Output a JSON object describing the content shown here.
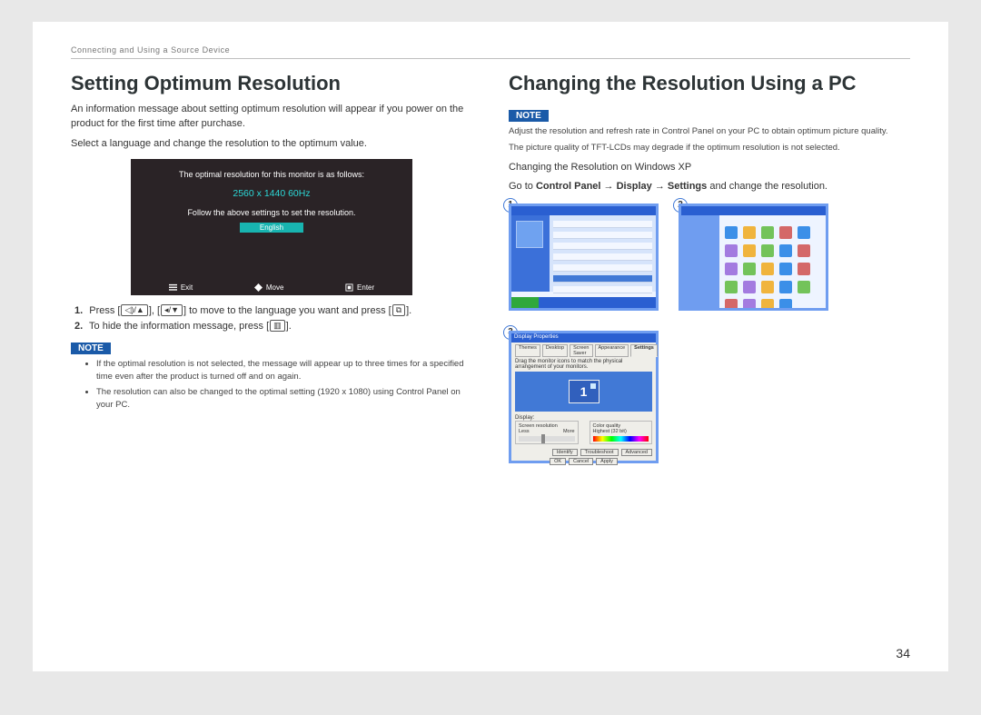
{
  "running_head": "Connecting and Using a Source Device",
  "page_number": "34",
  "left": {
    "heading": "Setting Optimum Resolution",
    "intro1": "An information message about setting optimum resolution will appear if you power on the product for the first time after purchase.",
    "intro2": "Select a language and change the resolution to the optimum value.",
    "osd": {
      "line1": "The optimal resolution for this monitor is as follows:",
      "resolution": "2560 x 1440  60Hz",
      "line2": "Follow the above settings to set the resolution.",
      "language": "English",
      "footer": {
        "exit": "Exit",
        "move": "Move",
        "enter": "Enter"
      }
    },
    "steps": [
      {
        "n": "1.",
        "pre": "Press [",
        "mid": "] to move to the language you want and press [",
        "post": "]."
      },
      {
        "n": "2.",
        "pre": "To hide the information message, press [",
        "post": "]."
      }
    ],
    "note_label": "NOTE",
    "notes": [
      "If the optimal resolution is not selected, the message will appear up to three times for a specified time even after the product is turned off and on again.",
      "The resolution can also be changed to the optimal setting (1920 x 1080) using Control Panel on your PC."
    ]
  },
  "right": {
    "heading": "Changing the Resolution Using a PC",
    "note_label": "NOTE",
    "notes": [
      "Adjust the resolution and refresh rate in Control Panel on your PC to obtain optimum picture quality.",
      "The picture quality of TFT-LCDs may degrade if the optimum resolution is not selected."
    ],
    "subheading": "Changing the Resolution on Windows XP",
    "instruction_pre": "Go to ",
    "instruction_cp": "Control Panel",
    "instruction_disp": "Display",
    "instruction_set": "Settings",
    "instruction_post": " and change the resolution.",
    "arrow": "→",
    "badges": [
      "1",
      "2",
      "3"
    ],
    "cp_icon_colors": [
      "#3b8fe8",
      "#f0b43d",
      "#73c35a",
      "#d46868",
      "#3b8fe8",
      "#a37be0",
      "#f0b43d",
      "#73c35a",
      "#3b8fe8",
      "#d46868",
      "#a37be0",
      "#73c35a",
      "#f0b43d",
      "#3b8fe8",
      "#d46868",
      "#73c35a",
      "#a37be0",
      "#f0b43d",
      "#3b8fe8",
      "#73c35a",
      "#d46868",
      "#a37be0",
      "#f0b43d",
      "#3b8fe8"
    ],
    "dialog": {
      "title": "Display Properties",
      "tabs": [
        "Themes",
        "Desktop",
        "Screen Saver",
        "Appearance",
        "Settings"
      ],
      "hint": "Drag the monitor icons to match the physical arrangement of your monitors.",
      "monitor_num": "1",
      "display_label": "Display:",
      "screen_res": "Screen resolution",
      "less": "Less",
      "more": "More",
      "color_q": "Color quality",
      "color_val": "Highest (32 bit)",
      "row_btns": [
        "Identify",
        "Troubleshoot",
        "Advanced"
      ],
      "ok_btns": [
        "OK",
        "Cancel",
        "Apply"
      ]
    }
  }
}
